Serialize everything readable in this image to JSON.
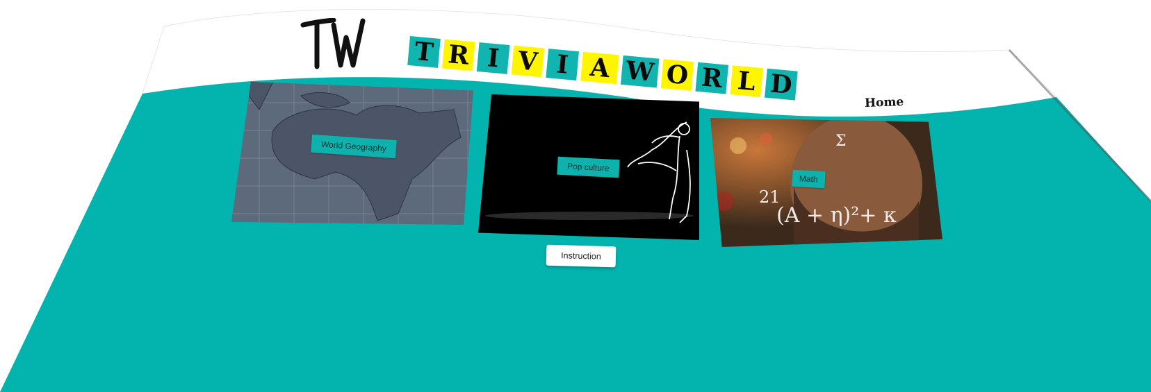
{
  "brand": {
    "logo_text": "TW",
    "title_letters": [
      "T",
      "R",
      "I",
      "V",
      "I",
      "A",
      "W",
      "O",
      "R",
      "L",
      "D"
    ]
  },
  "nav": {
    "home_label": "Home"
  },
  "categories": [
    {
      "label": "World Geography",
      "image": "world-map"
    },
    {
      "label": "Pop culture",
      "image": "dancer-sketch"
    },
    {
      "label": "Math",
      "image": "math-meme"
    }
  ],
  "instruction_label": "Instruction",
  "colors": {
    "teal": "#02b3ae",
    "tile_teal": "#12b4b0",
    "tile_yellow": "#fff500",
    "header_white": "#ffffff"
  }
}
